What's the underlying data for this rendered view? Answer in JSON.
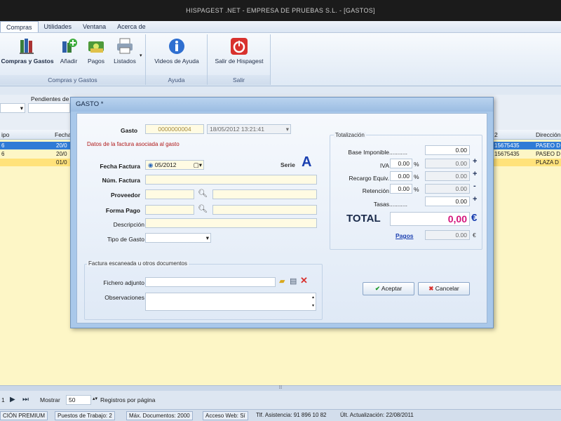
{
  "window": {
    "title": "HISPAGEST .NET - EMPRESA DE PRUEBAS S.L. - [GASTOS]"
  },
  "menu": {
    "tabs": [
      "Compras",
      "Utilidades",
      "Ventana",
      "Acerca de"
    ]
  },
  "ribbon": {
    "groups": [
      {
        "caption": "Compras y Gastos",
        "buttons": [
          "Compras y Gastos",
          "Añadir",
          "Pagos",
          "Listados"
        ]
      },
      {
        "caption": "Ayuda",
        "buttons": [
          "Videos de Ayuda"
        ]
      },
      {
        "caption": "Salir",
        "buttons": [
          "Salir de Hispagest"
        ]
      }
    ]
  },
  "background": {
    "filter_label": "Pendientes de",
    "columns": [
      "ipo",
      "Fecha",
      "2",
      "Dirección"
    ],
    "rows": [
      {
        "c1": "6",
        "c2": "20/0",
        "c3": "15675435",
        "c4": "PASEO D"
      },
      {
        "c1": "6",
        "c2": "20/0",
        "c3": "15675435",
        "c4": "PASEO D"
      },
      {
        "c1": "",
        "c2": "01/0",
        "c3": "",
        "c4": "PLAZA D"
      }
    ]
  },
  "dialog": {
    "title": "GASTO *",
    "gasto_label": "Gasto",
    "gasto_number": "0000000004",
    "gasto_datetime": "18/05/2012 13:21:41",
    "section_title": "Datos de la factura asociada al gasto",
    "fecha_label": "Fecha Factura",
    "fecha_value": "05/2012",
    "serie_label": "Serie",
    "serie_value": "A",
    "num_factura_label": "Núm. Factura",
    "proveedor_label": "Proveedor",
    "forma_pago_label": "Forma Pago",
    "descripcion_label": "Descripción",
    "tipo_gasto_label": "Tipo de Gasto",
    "docs_title": "Factura escaneada u otros documentos",
    "fichero_label": "Fichero adjunto",
    "observaciones_label": "Observaciones",
    "totales": {
      "title": "Totalización",
      "base_label": "Base Imponible",
      "base_value": "0.00",
      "iva_label": "IVA",
      "iva_pct": "0.00",
      "iva_value": "0.00",
      "recargo_label": "Recargo Equiv.",
      "recargo_pct": "0.00",
      "recargo_value": "0.00",
      "retencion_label": "Retención",
      "retencion_pct": "0.00",
      "retencion_value": "0.00",
      "tasas_label": "Tasas",
      "tasas_value": "0.00",
      "total_label": "TOTAL",
      "total_value": "0,00",
      "currency": "€",
      "pagos_label": "Pagos",
      "pagos_value": "0.00",
      "pct": "%",
      "plus": "+",
      "minus": "-"
    },
    "aceptar_label": "Aceptar",
    "cancelar_label": "Cancelar"
  },
  "pager": {
    "mostrar_label": "Mostrar",
    "mostrar_value": "50",
    "registros_label": "Registros por página",
    "page": "1"
  },
  "status": {
    "items": [
      "CIÓN PREMIUM",
      "Puestos de Trabajo: 2",
      "Máx. Documentos: 2000",
      "Acceso Web: Sí",
      "Tlf. Asistencia: 91 896 10 82",
      "Últ. Actualización: 22/08/2011"
    ]
  },
  "colors": {
    "accent": "#2f7bd6",
    "total": "#d4147c",
    "highlight_row": "#ffe27a",
    "grid_bg": "#fdf6c6"
  }
}
